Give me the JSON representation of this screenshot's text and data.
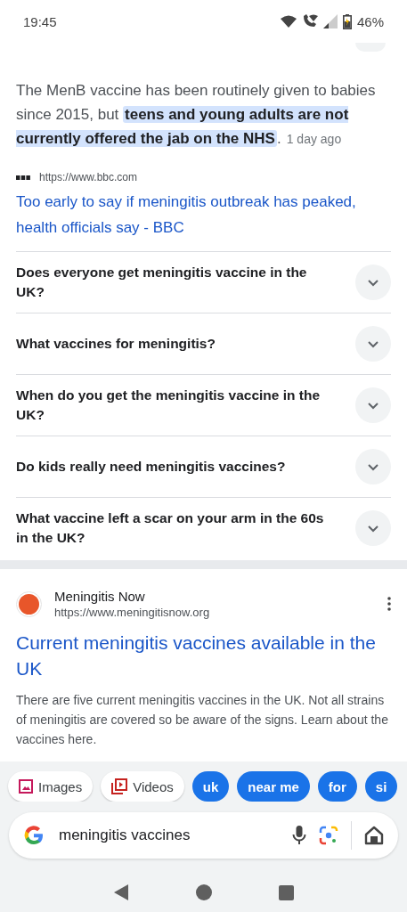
{
  "status_bar": {
    "time": "19:45",
    "battery": "46%"
  },
  "snippet": {
    "text": "The MenB vaccine has been routinely given to babies since 2015, but **teens and young adults are not currently offered the jab on the NHS**.",
    "date": "1 day ago",
    "source_url": "https://www.bbc.com",
    "link": "Too early to say if meningitis outbreak has peaked, health officials say - BBC"
  },
  "questions": [
    {
      "text": "Does everyone get meningitis vaccine in the UK?"
    },
    {
      "text": "What vaccines for meningitis?"
    },
    {
      "text": "When do you get the meningitis vaccine in the UK?"
    },
    {
      "text": "Do kids really need meningitis vaccines?"
    },
    {
      "text": "What vaccine left a scar on your arm in the 60s in the UK?"
    }
  ],
  "result": {
    "site": "Meningitis Now",
    "url": "https://www.meningitisnow.org",
    "color": "#e8562a",
    "title": "Current meningitis vaccines available in the UK",
    "description": "There are five current meningitis vaccines in the UK. Not all strains of meningitis are covered so be aware of the signs. Learn about the vaccines here."
  },
  "chips": [
    {
      "kind": "images",
      "label": "Images"
    },
    {
      "kind": "videos",
      "label": "Videos"
    },
    {
      "kind": "suggestion",
      "label": "uk"
    },
    {
      "kind": "suggestion",
      "label": "near me"
    },
    {
      "kind": "suggestion",
      "label": "for"
    },
    {
      "kind": "suggestion",
      "label": "si"
    }
  ],
  "search": {
    "value": "meningitis vaccines"
  }
}
